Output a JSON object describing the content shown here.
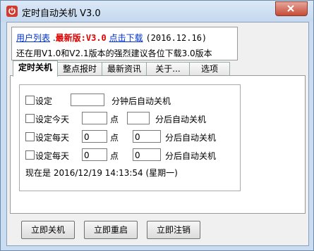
{
  "window": {
    "title": "定时自动关机 V3.0"
  },
  "info": {
    "user_list": "用户列表",
    "dot": " .",
    "latest_label": "最新版:V3.0",
    "download_link": "点击下载",
    "date": "(2016.12.16)",
    "notice": "还在用V1.0和V2.1版本的强烈建议各位下载3.0版本"
  },
  "tabs": [
    "定时关机",
    "整点报时",
    "最新资讯",
    "关于...",
    "选项"
  ],
  "rows": [
    {
      "label": "设定",
      "value1": "",
      "mid": "",
      "value2": "",
      "suffix": "分钟后自动关机"
    },
    {
      "label": "设定今天",
      "value1": "",
      "mid": "点",
      "value2": "",
      "suffix": "分后自动关机"
    },
    {
      "label": "设定每天",
      "value1": "0",
      "mid": "点",
      "value2": "0",
      "suffix": "分后自动关机"
    },
    {
      "label": "设定每天",
      "value1": "0",
      "mid": "点",
      "value2": "0",
      "suffix": "分后自动关机"
    }
  ],
  "now_text": "现在是 2016/12/19 14:13:54 (星期一)",
  "buttons": {
    "shutdown": "立即关机",
    "restart": "立即重启",
    "logoff": "立即注销"
  }
}
